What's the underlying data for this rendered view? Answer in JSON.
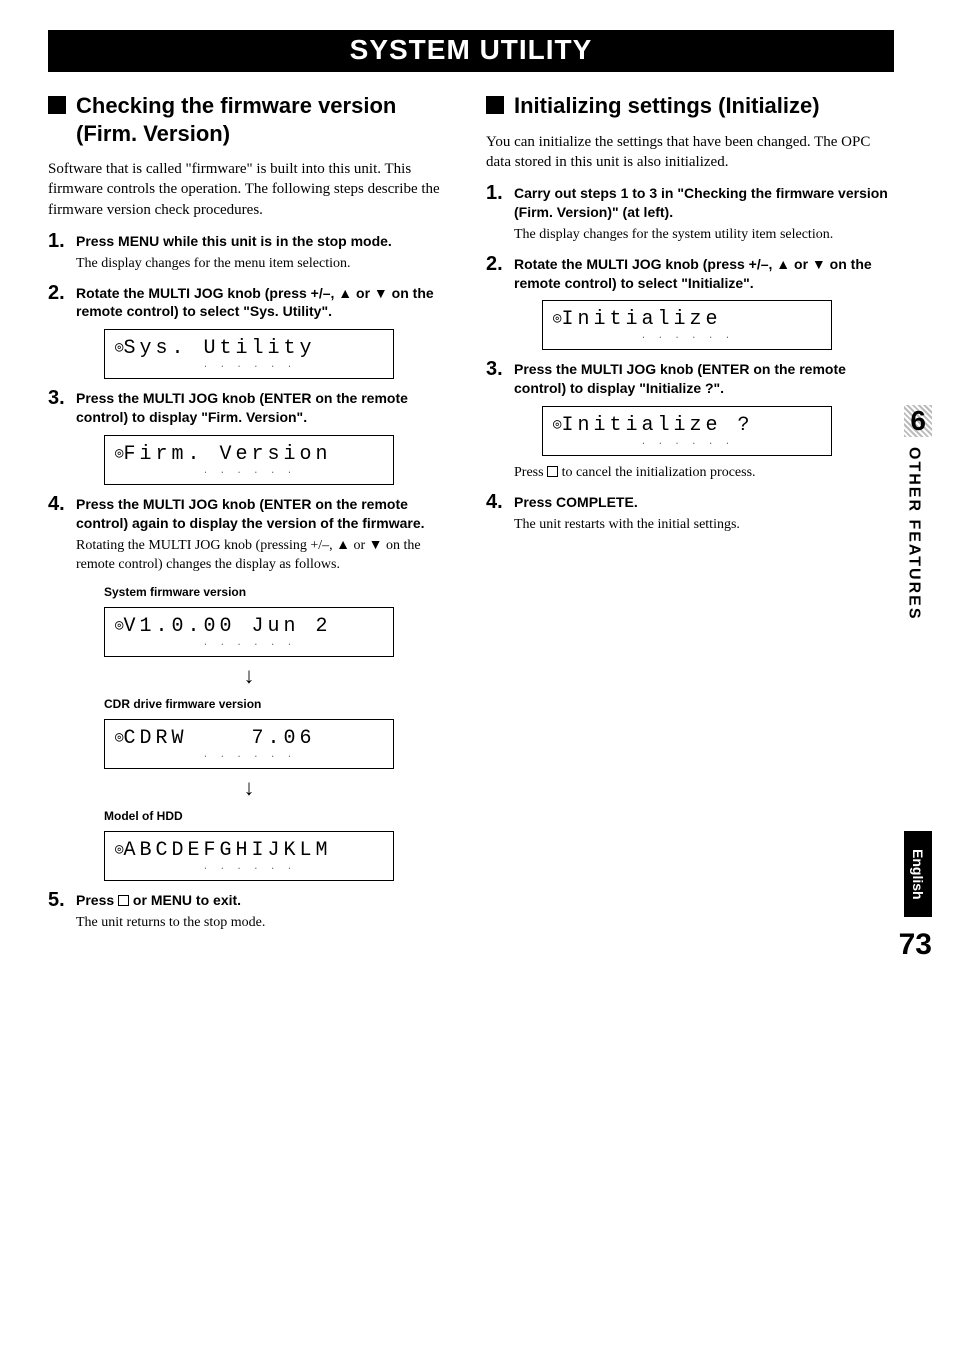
{
  "banner": "SYSTEM UTILITY",
  "left": {
    "heading": "Checking the firmware version (Firm. Version)",
    "intro": "Software that is called \"firmware\" is built into this unit. This firmware controls the operation. The following steps describe the firmware version check procedures.",
    "steps": [
      {
        "head": "Press MENU while this unit is in the stop mode.",
        "body": "The display changes for the menu item selection."
      },
      {
        "head": "Rotate the MULTI JOG knob (press +/–, ▲ or ▼ on the remote control) to select \"Sys. Utility\".",
        "lcd": "Sys. Utility"
      },
      {
        "head": "Press the MULTI JOG knob (ENTER on the remote control) to display \"Firm. Version\".",
        "lcd": "Firm. Version"
      },
      {
        "head": "Press the MULTI JOG knob (ENTER on the remote control) again to display the version of the firmware.",
        "body": "Rotating the MULTI JOG knob (pressing +/–, ▲ or ▼ on the remote control) changes the display as follows.",
        "seq": [
          {
            "caption": "System firmware version",
            "lcd": "V1.0.00 Jun 2"
          },
          {
            "caption": "CDR drive firmware version",
            "lcd": "CDRW    7.06"
          },
          {
            "caption": "Model of HDD",
            "lcd": "ABCDEFGHIJKLM"
          }
        ]
      },
      {
        "head_prefix": "Press ",
        "head_suffix": " or MENU to exit.",
        "body": "The unit returns to the stop mode."
      }
    ]
  },
  "right": {
    "heading": "Initializing settings (Initialize)",
    "intro": "You can initialize the settings that have been changed. The OPC data stored in this unit is also initialized.",
    "steps": [
      {
        "head": "Carry out steps 1 to 3 in \"Checking the firmware version (Firm. Version)\" (at left).",
        "body": "The display changes for the system utility item selection."
      },
      {
        "head": "Rotate the MULTI JOG knob (press +/–, ▲ or ▼ on the remote control) to select \"Initialize\".",
        "lcd": "Initialize"
      },
      {
        "head": "Press the MULTI JOG knob (ENTER on the remote control) to display \"Initialize ?\".",
        "lcd": "Initialize ?",
        "after_prefix": "Press ",
        "after_suffix": " to cancel the initialization process."
      },
      {
        "head": "Press COMPLETE.",
        "body": "The unit restarts with the initial settings."
      }
    ]
  },
  "side": {
    "chapter": "6",
    "section": "OTHER FEATURES"
  },
  "footer": {
    "language": "English",
    "page": "73"
  },
  "lcd_sub": "· · · · · ·"
}
